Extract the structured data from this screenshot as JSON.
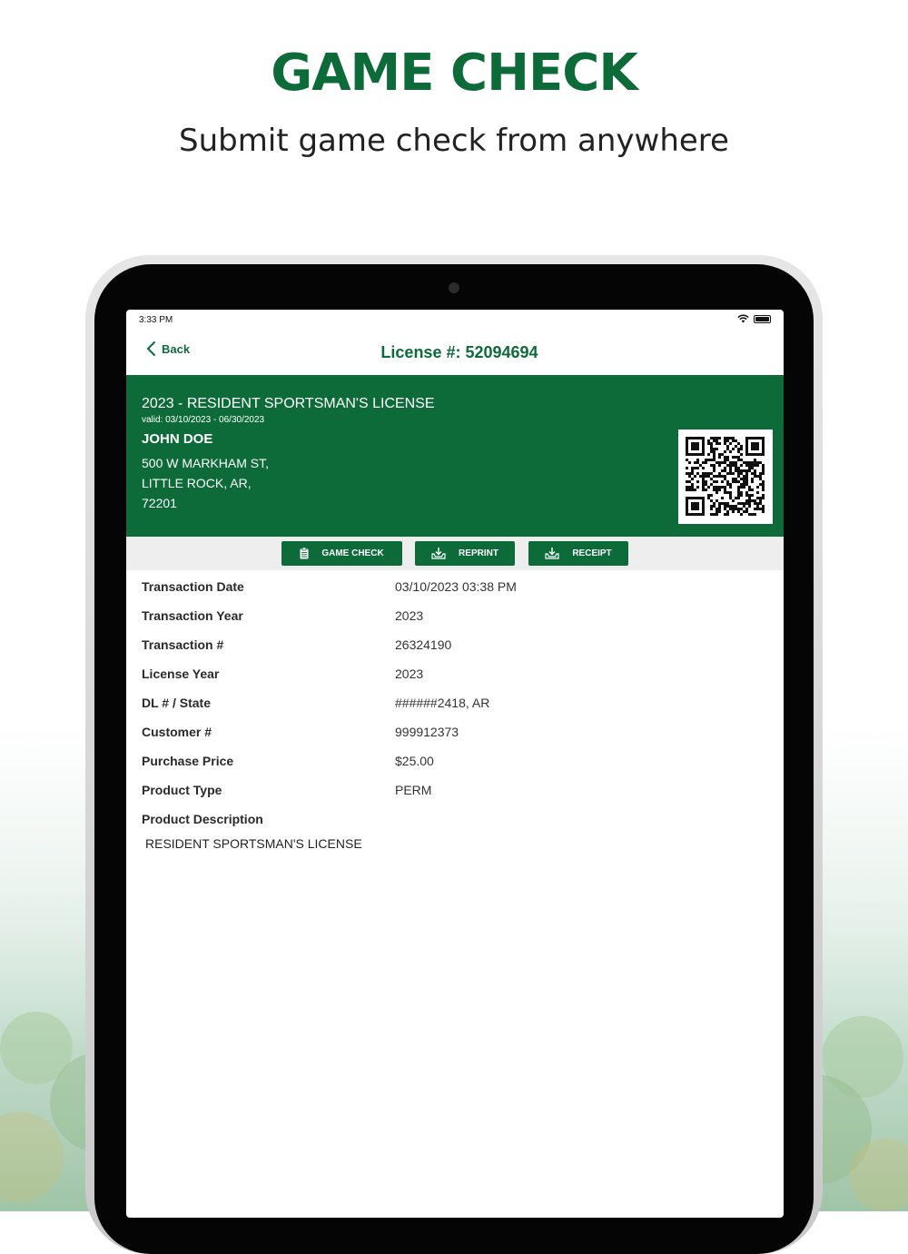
{
  "promo": {
    "headline": "GAME CHECK",
    "subheadline": "Submit game check from anywhere"
  },
  "status_bar": {
    "time": "3:33 PM",
    "icons": [
      "wifi-icon",
      "battery-icon"
    ]
  },
  "nav": {
    "back_label": "Back",
    "title": "License #: 52094694"
  },
  "license": {
    "name": "2023 - RESIDENT SPORTSMAN'S LICENSE",
    "valid": "valid: 03/10/2023 - 06/30/2023",
    "holder": "JOHN DOE",
    "address_line1": "500 W MARKHAM ST,",
    "address_line2": "LITTLE ROCK, AR,",
    "address_line3": "72201"
  },
  "actions": {
    "game_check": "GAME CHECK",
    "reprint": "REPRINT",
    "receipt": "RECEIPT"
  },
  "details": {
    "rows": [
      {
        "label": "Transaction Date",
        "value": "03/10/2023 03:38 PM"
      },
      {
        "label": "Transaction Year",
        "value": "2023"
      },
      {
        "label": "Transaction #",
        "value": "26324190"
      },
      {
        "label": "License Year",
        "value": "2023"
      },
      {
        "label": "DL # / State",
        "value": "######2418, AR"
      },
      {
        "label": "Customer #",
        "value": "999912373"
      },
      {
        "label": "Purchase Price",
        "value": "$25.00"
      },
      {
        "label": "Product Type",
        "value": "PERM"
      }
    ],
    "description_label": "Product Description",
    "description_value": "RESIDENT SPORTSMAN'S LICENSE"
  },
  "colors": {
    "brand_green": "#0d6b39",
    "action_bar_bg": "#eeeeee"
  }
}
